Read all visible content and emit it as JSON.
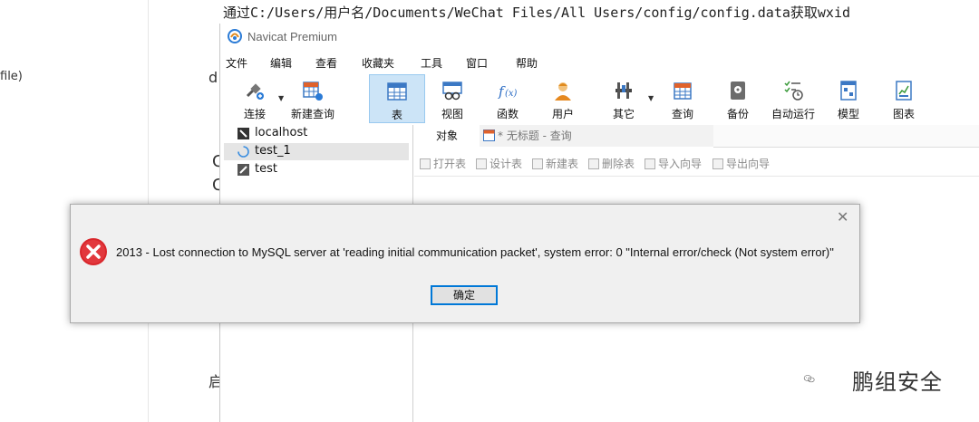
{
  "background": {
    "left_text": "file)",
    "article_chars": [
      "d",
      "C",
      "C",
      "启"
    ],
    "path_line": "通过C:/Users/用户名/Documents/WeChat Files/All Users/config/config.data获取wxid"
  },
  "window": {
    "title": "Navicat Premium",
    "menu": [
      "文件",
      "编辑",
      "查看",
      "收藏夹",
      "工具",
      "窗口",
      "帮助"
    ],
    "toolbar": [
      {
        "label": "连接",
        "icon": "connect-icon"
      },
      {
        "label": "新建查询",
        "icon": "new-query-icon"
      },
      {
        "label": "表",
        "icon": "table-icon"
      },
      {
        "label": "视图",
        "icon": "view-icon"
      },
      {
        "label": "函数",
        "icon": "function-icon"
      },
      {
        "label": "用户",
        "icon": "user-icon"
      },
      {
        "label": "其它",
        "icon": "other-icon"
      },
      {
        "label": "查询",
        "icon": "query-icon"
      },
      {
        "label": "备份",
        "icon": "backup-icon"
      },
      {
        "label": "自动运行",
        "icon": "schedule-icon"
      },
      {
        "label": "模型",
        "icon": "model-icon"
      },
      {
        "label": "图表",
        "icon": "chart-icon"
      }
    ],
    "connections": [
      {
        "label": "localhost"
      },
      {
        "label": "test_1"
      },
      {
        "label": "test"
      }
    ],
    "tabs": {
      "objects": "对象",
      "query": "* 无标题 - 查询"
    },
    "object_toolbar": [
      "打开表",
      "设计表",
      "新建表",
      "删除表",
      "导入向导",
      "导出向导"
    ]
  },
  "dialog": {
    "message": "2013 - Lost connection to MySQL server at 'reading initial communication packet', system error: 0 \"Internal error/check (Not system error)\"",
    "ok_label": "确定"
  },
  "watermark": {
    "text": "鹏组安全"
  },
  "colors": {
    "selected_toolbar_bg": "#cce4f7",
    "error_red": "#d9262b",
    "ok_button_border": "#0078d7"
  }
}
